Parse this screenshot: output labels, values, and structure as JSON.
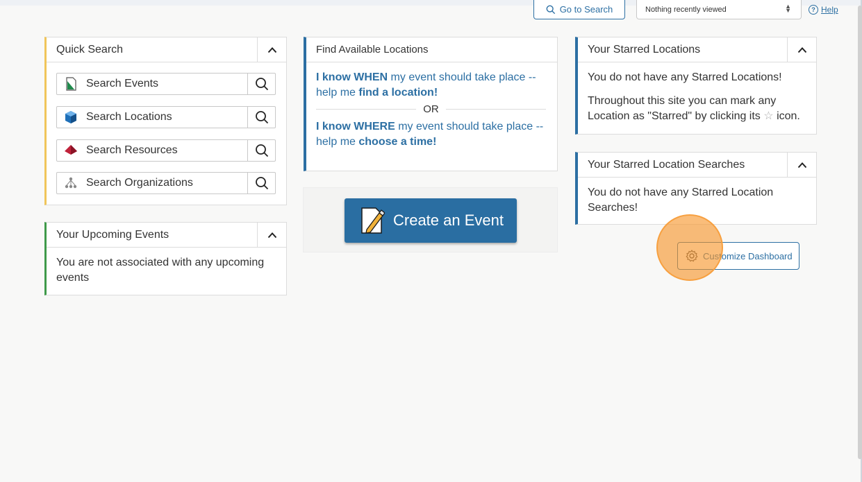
{
  "topbar": {
    "goto_search": "Go to Search",
    "recent_viewed": "Nothing recently viewed",
    "help": "Help"
  },
  "quick_search": {
    "title": "Quick Search",
    "items": [
      {
        "label": "Search Events",
        "icon": "document-icon"
      },
      {
        "label": "Search Locations",
        "icon": "cube-icon"
      },
      {
        "label": "Search Resources",
        "icon": "diamond-icon"
      },
      {
        "label": "Search Organizations",
        "icon": "org-chart-icon"
      }
    ]
  },
  "upcoming": {
    "title": "Your Upcoming Events",
    "body": "You are not associated with any upcoming events"
  },
  "find_locations": {
    "title": "Find Available Locations",
    "when_bold": "I know WHEN",
    "when_mid": " my event should take place -- help me ",
    "when_action": "find a location!",
    "or": "OR",
    "where_bold": "I know WHERE",
    "where_mid": " my event should take place -- help me ",
    "where_action": "choose a time!"
  },
  "create_event": {
    "label": "Create an Event"
  },
  "starred_locations": {
    "title": "Your Starred Locations",
    "line1": "You do not have any Starred Locations!",
    "line2a": "Throughout this site you can mark any Location as \"Starred\" by clicking its",
    "line2b": "icon."
  },
  "starred_searches": {
    "title": "Your Starred Location Searches",
    "body": "You do not have any Starred Location Searches!"
  },
  "customize": {
    "label": "Customize Dashboard"
  },
  "colors": {
    "accent_blue": "#2c6fa3",
    "accent_yellow": "#f0c55a",
    "accent_green": "#3f9a4a",
    "click_marker": "#f79428"
  }
}
